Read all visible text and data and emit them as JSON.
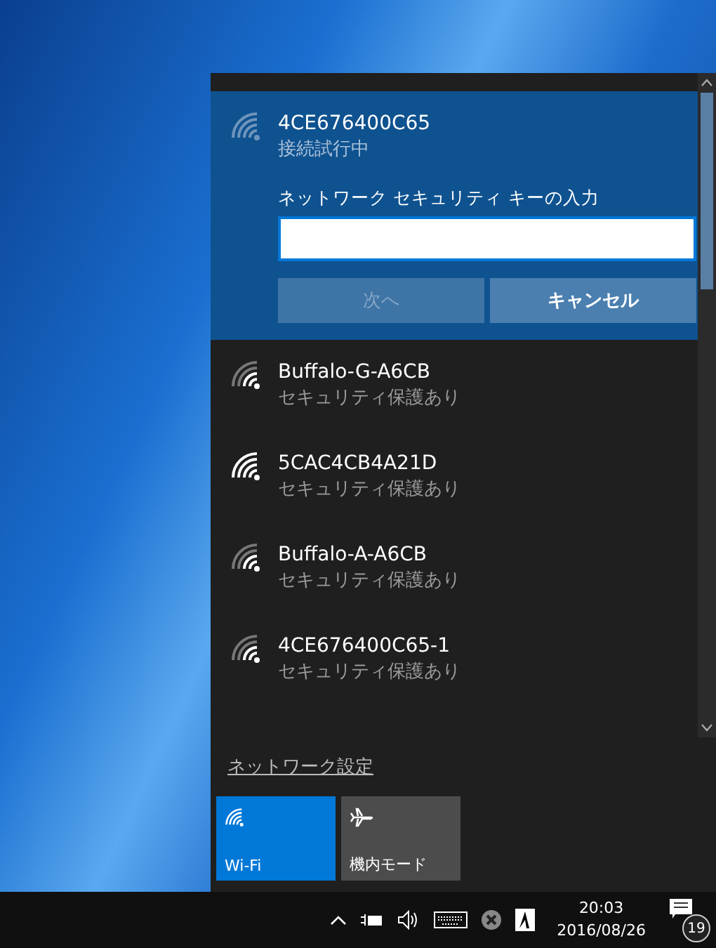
{
  "connecting": {
    "name": "4CE676400C65",
    "status": "接続試行中",
    "key_label": "ネットワーク セキュリティ キーの入力",
    "buttons": [
      {
        "label": "次へ",
        "disabled": true
      },
      {
        "label": "キャンセル",
        "disabled": false
      }
    ]
  },
  "networks": [
    {
      "name": "Buffalo-G-A6CB",
      "security": "セキュリティ保護あり"
    },
    {
      "name": "5CAC4CB4A21D",
      "security": "セキュリティ保護あり"
    },
    {
      "name": "Buffalo-A-A6CB",
      "security": "セキュリティ保護あり"
    },
    {
      "name": "4CE676400C65-1",
      "security": "セキュリティ保護あり"
    }
  ],
  "settings_link": "ネットワーク設定",
  "tiles": [
    {
      "label": "Wi-Fi",
      "kind": "wifi",
      "on": true
    },
    {
      "label": "機内モード",
      "kind": "airplane",
      "on": false
    }
  ],
  "taskbar": {
    "time": "20:03",
    "date": "2016/08/26",
    "notifications": "19"
  }
}
